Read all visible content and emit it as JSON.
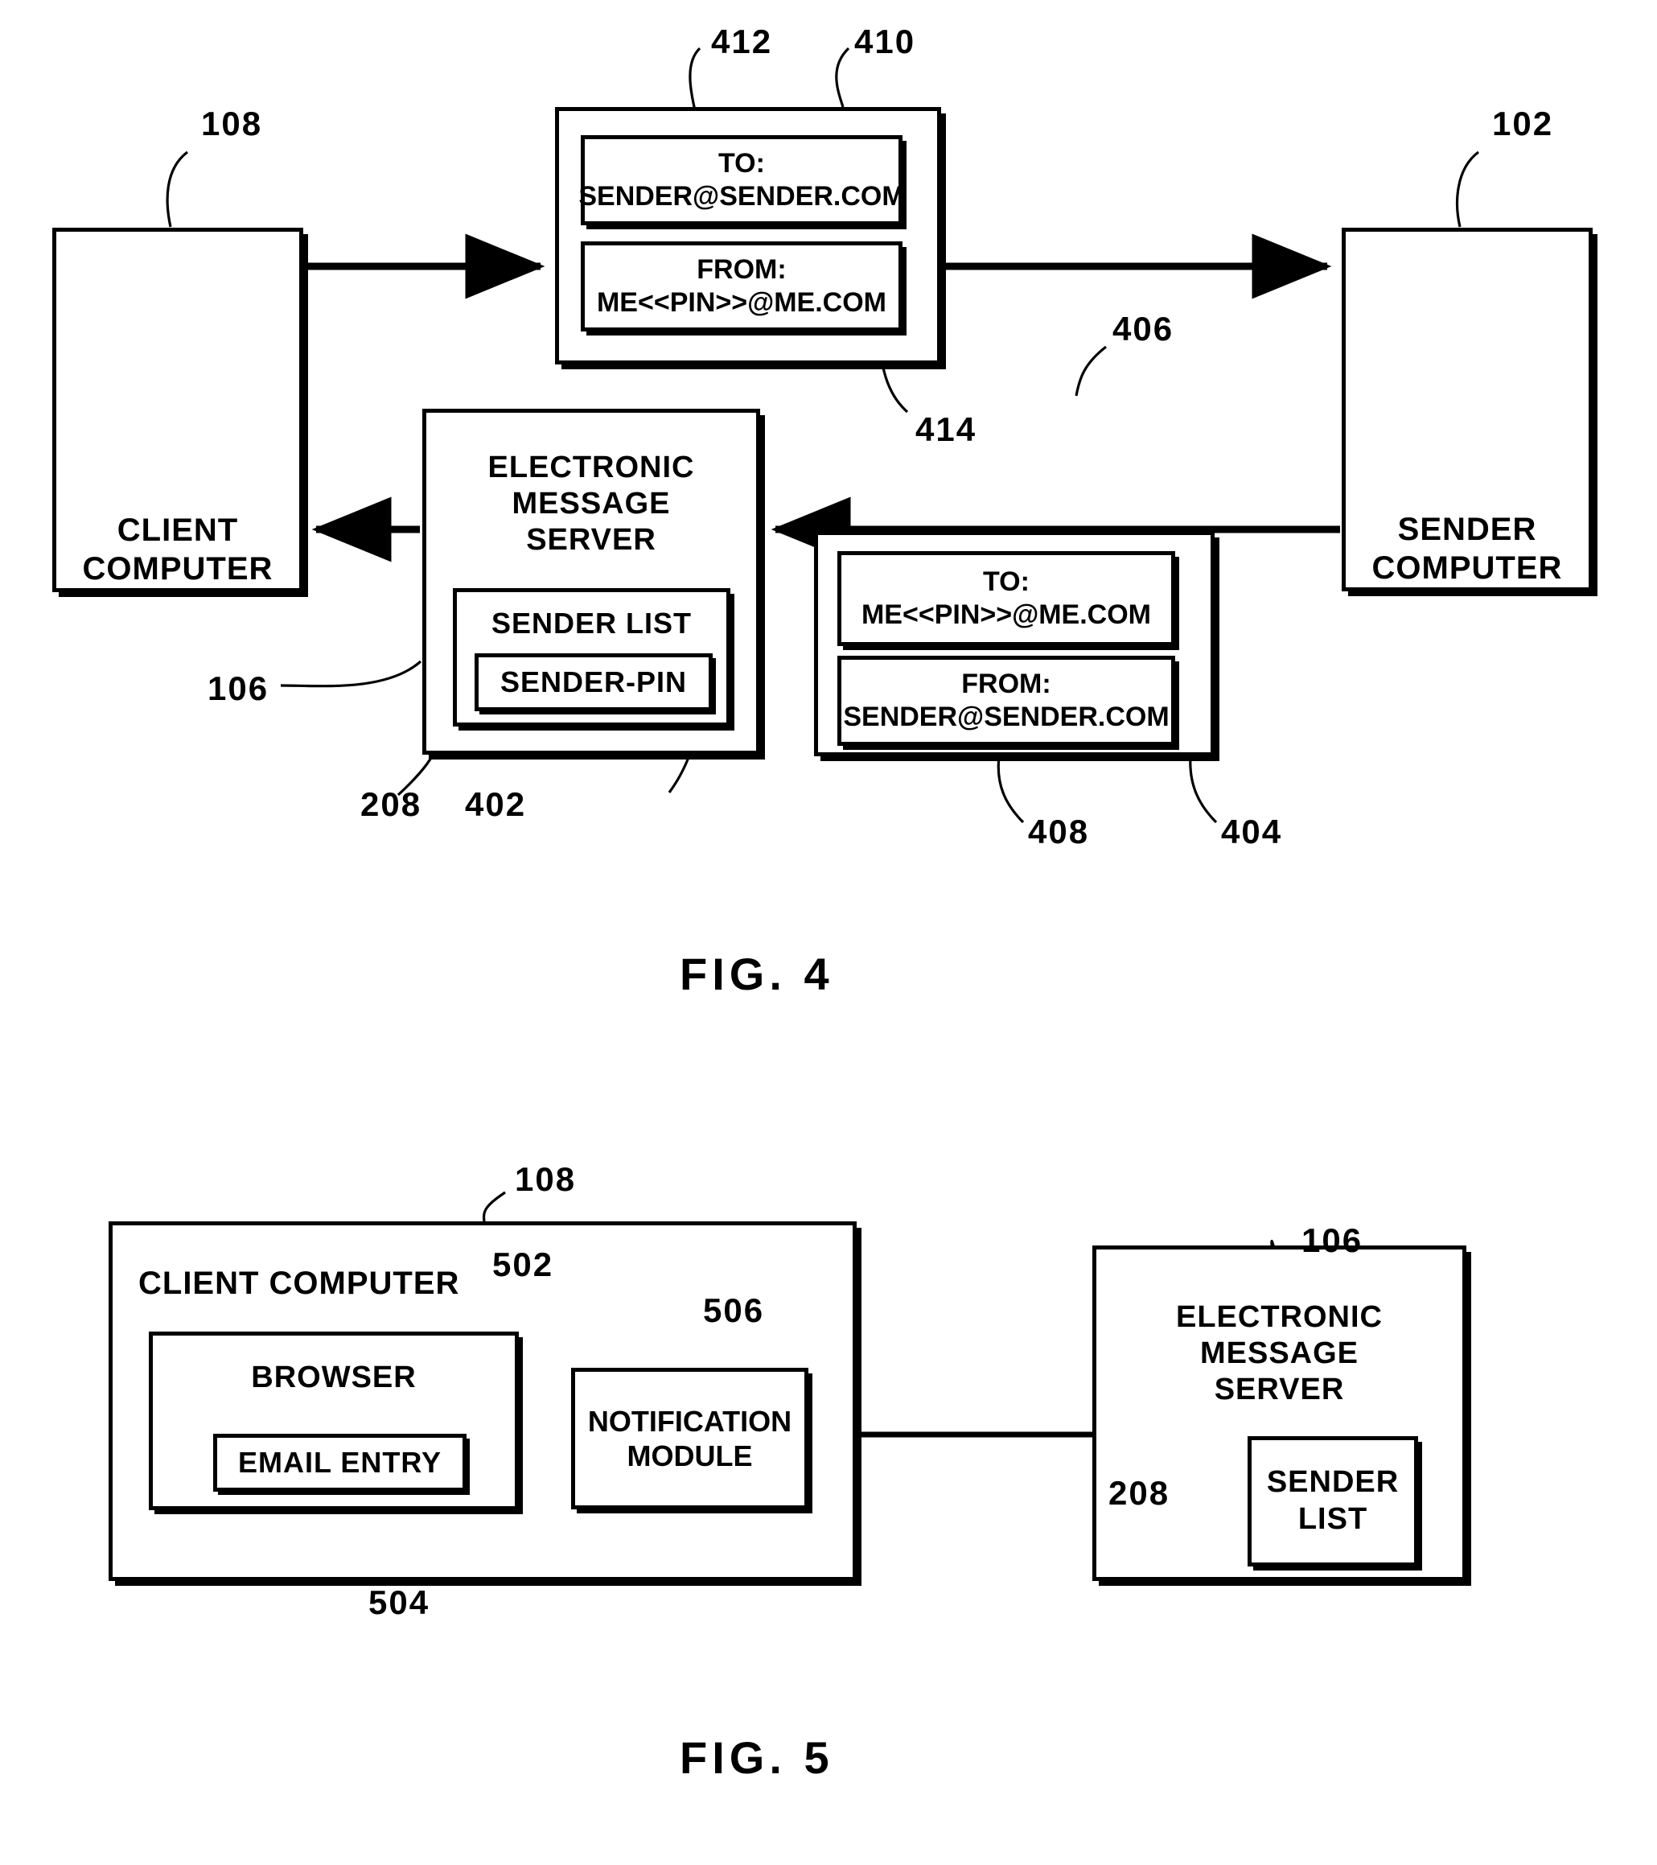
{
  "document": {
    "type": "patent-drawing-sheet",
    "figures": [
      "FIG. 4",
      "FIG. 5"
    ]
  },
  "fig4": {
    "caption": "FIG. 4",
    "client_computer": {
      "label": "CLIENT\nCOMPUTER",
      "ref": "108"
    },
    "sender_computer": {
      "label": "SENDER\nCOMPUTER",
      "ref": "102"
    },
    "message_outbound": {
      "ref": "410",
      "to_line": "TO: SENDER@SENDER.COM",
      "to_ref": "412",
      "from_line": "FROM: ME<<PIN>>@ME.COM",
      "from_ref": "414"
    },
    "message_inbound": {
      "ref": "404",
      "to_line": "TO: ME<<PIN>>@ME.COM",
      "to_ref": "406",
      "from_line": "FROM: SENDER@SENDER.COM",
      "from_ref": "408"
    },
    "message_server": {
      "label": "ELECTRONIC\nMESSAGE\nSERVER",
      "ref": "106",
      "sender_list": {
        "label": "SENDER LIST",
        "ref": "208",
        "sender_pin": {
          "label": "SENDER-PIN",
          "ref": "402"
        }
      }
    }
  },
  "fig5": {
    "caption": "FIG. 5",
    "client_computer": {
      "label": "CLIENT COMPUTER",
      "ref": "108",
      "browser": {
        "label": "BROWSER",
        "ref": "502",
        "email_entry": {
          "label": "EMAIL ENTRY",
          "ref": "504"
        }
      },
      "notification_module": {
        "label": "NOTIFICATION\nMODULE",
        "ref": "506"
      }
    },
    "message_server": {
      "label": "ELECTRONIC MESSAGE\nSERVER",
      "ref": "106",
      "sender_list": {
        "label": "SENDER\nLIST",
        "ref": "208"
      }
    }
  },
  "colors": {
    "ink": "#000000",
    "paper": "#ffffff"
  }
}
